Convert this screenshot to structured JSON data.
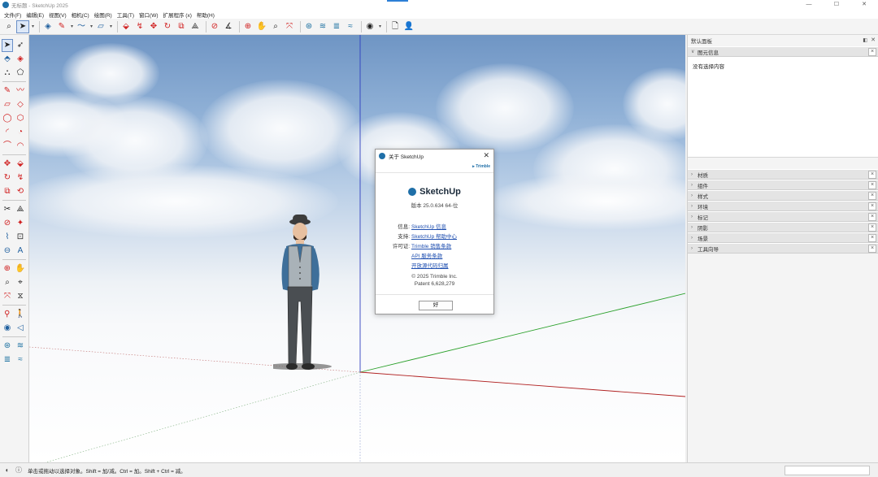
{
  "window": {
    "title": "无标题 - SketchUp 2025",
    "minimize": "—",
    "maximize": "☐",
    "close": "✕"
  },
  "menu": [
    "文件(F)",
    "编辑(E)",
    "视图(V)",
    "相机(C)",
    "绘图(R)",
    "工具(T)",
    "窗口(W)",
    "扩展程序 (x)",
    "帮助(H)"
  ],
  "toolbar": {
    "icons": [
      "search-icon",
      "select-arrow-icon",
      "eraser-icon",
      "pencil-line-icon",
      "freehand-icon",
      "rectangle-icon",
      "pushpull-icon",
      "move-icon",
      "rotate-icon",
      "scale-icon",
      "offset-icon",
      "followme-icon",
      "tape-measure-icon",
      "protractor-icon",
      "orbit-icon",
      "pan-icon",
      "zoom-icon",
      "zoom-extents-icon",
      "warehouse-icon",
      "extension-icon",
      "layers-icon",
      "account-icon",
      "document-icon",
      "user-icon"
    ]
  },
  "viewport": {
    "colors": {
      "sky_top": "#6f95c4",
      "ground": "#ffffff",
      "x_axis": "#c02020",
      "y_axis": "#20a020",
      "z_axis": "#2030c0"
    }
  },
  "dialog": {
    "title": "关于 SketchUp",
    "trimble": "⫸ Trimble",
    "brand": "SketchUp",
    "version": "版本 25.0.634 64-位",
    "info": [
      {
        "key": "信息:",
        "value": "SketchUp 信息"
      },
      {
        "key": "支持:",
        "value": "SketchUp 帮助中心"
      },
      {
        "key": "许可证:",
        "value": "Trimble 销售条款"
      },
      {
        "key": "",
        "value": "API 服务条款"
      },
      {
        "key": "",
        "value": "开放源代码归属"
      }
    ],
    "copyright": "© 2025 Trimble Inc.",
    "patent": "Patent 6,628,279",
    "ok": "好"
  },
  "panel": {
    "title": "默认面板",
    "entity_info": {
      "label": "图元信息",
      "empty_text": "没有选择内容"
    },
    "trays": [
      "材质",
      "组件",
      "样式",
      "标记",
      "阴影",
      "场景",
      "工具向导"
    ],
    "trays_full": [
      "材质",
      "组件",
      "样式",
      "环境",
      "标记",
      "阴影",
      "场景",
      "工具向导"
    ]
  },
  "status": {
    "text": "单击或拖动以选择对象。Shift = 加/减。Ctrl = 加。Shift + Ctrl = 减。"
  }
}
